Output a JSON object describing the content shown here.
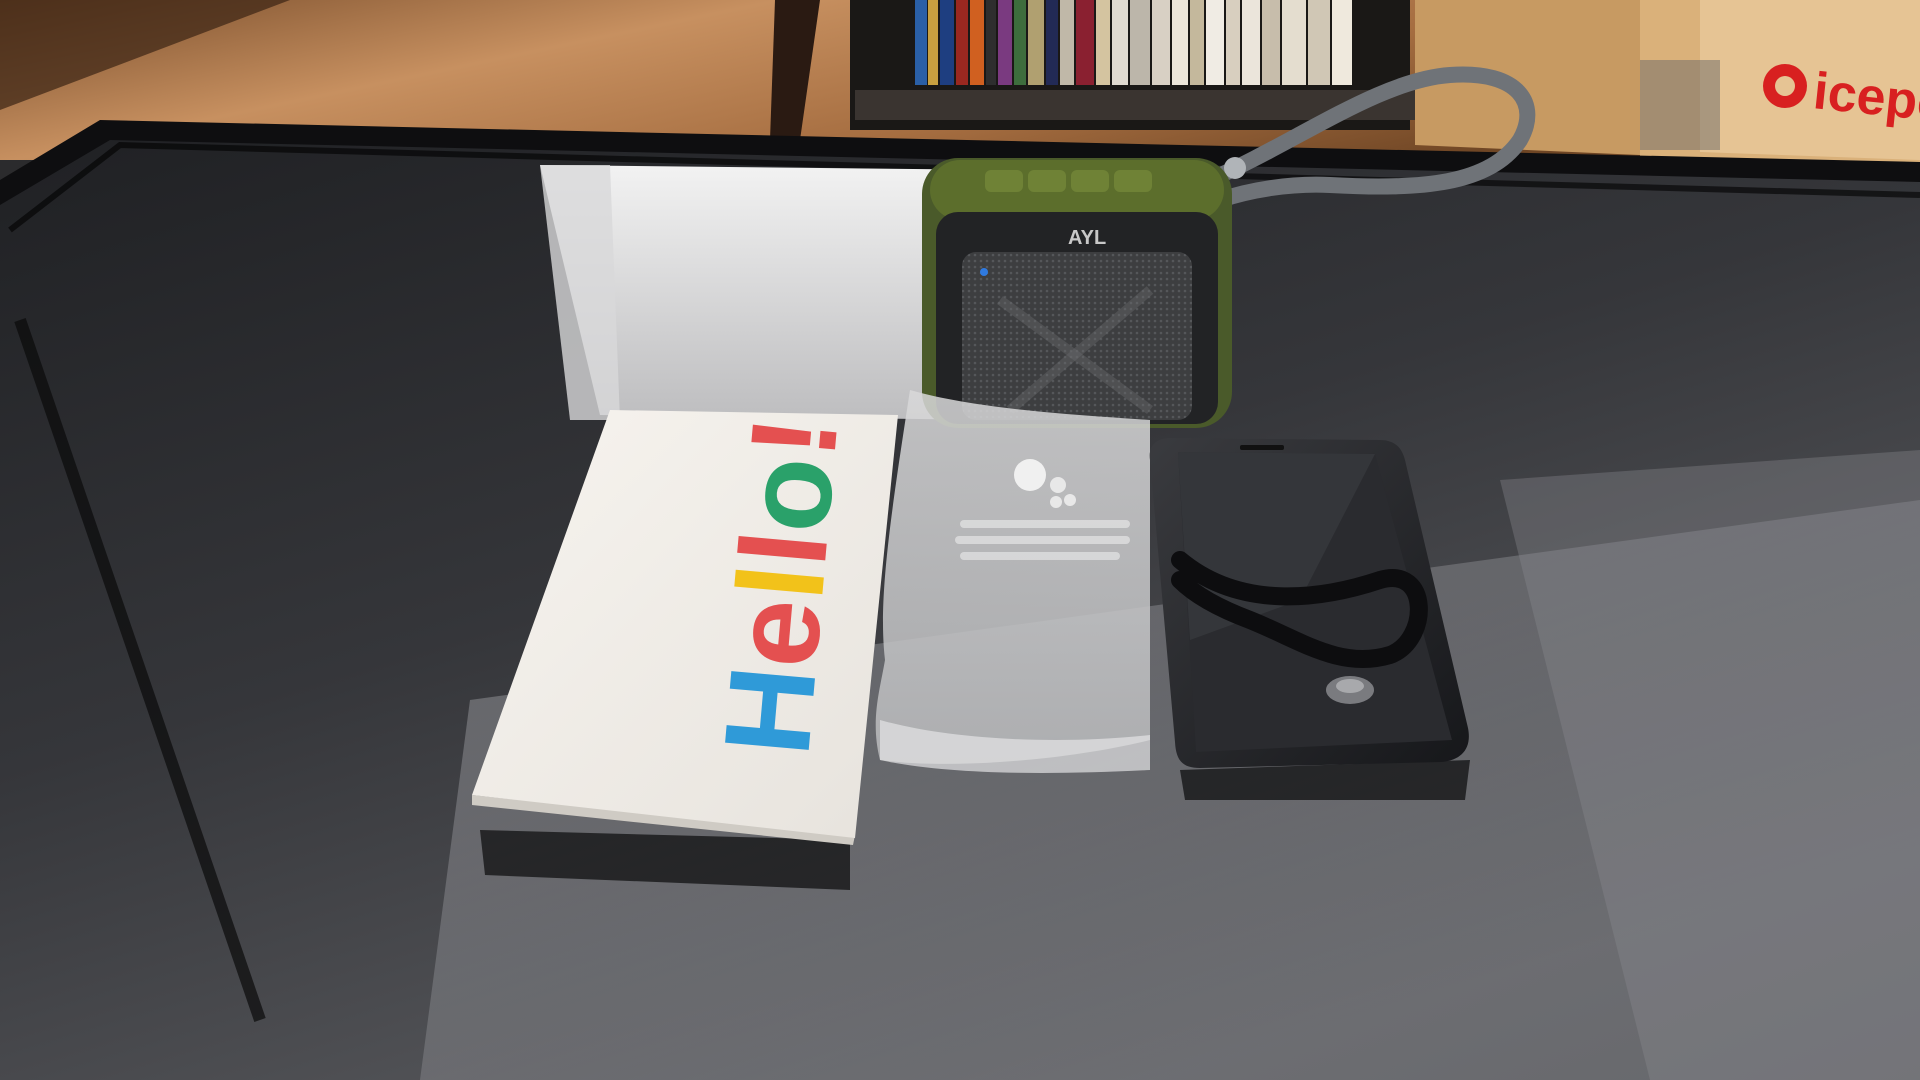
{
  "scene": {
    "description_kind": "photo",
    "objects": [
      "bookshelf",
      "wood-floor",
      "glass-table",
      "bluetooth-speaker",
      "hello-box",
      "google-assistant-sleeve",
      "smartphone"
    ]
  },
  "speaker": {
    "brand": "AYL",
    "body_color": "#4a5a2a",
    "accent_color": "#5c6e2c",
    "led_color": "#2f7ae0"
  },
  "hello_box": {
    "text_letters": [
      "H",
      "e",
      "l",
      "l",
      "o",
      "!"
    ],
    "letter_colors": [
      "#2f9ad8",
      "#e45050",
      "#f2c21a",
      "#e45050",
      "#2aa16a",
      "#e45050"
    ]
  },
  "sleeve": {
    "logo": "google-assistant-dots"
  },
  "background_box": {
    "brand_fragment": "icepo",
    "logo_color": "#d82020"
  },
  "colors": {
    "table_dark": "#2a2b2e",
    "table_light": "#6b6c70",
    "floor": "#b98152",
    "box_white": "#eeeae4"
  }
}
